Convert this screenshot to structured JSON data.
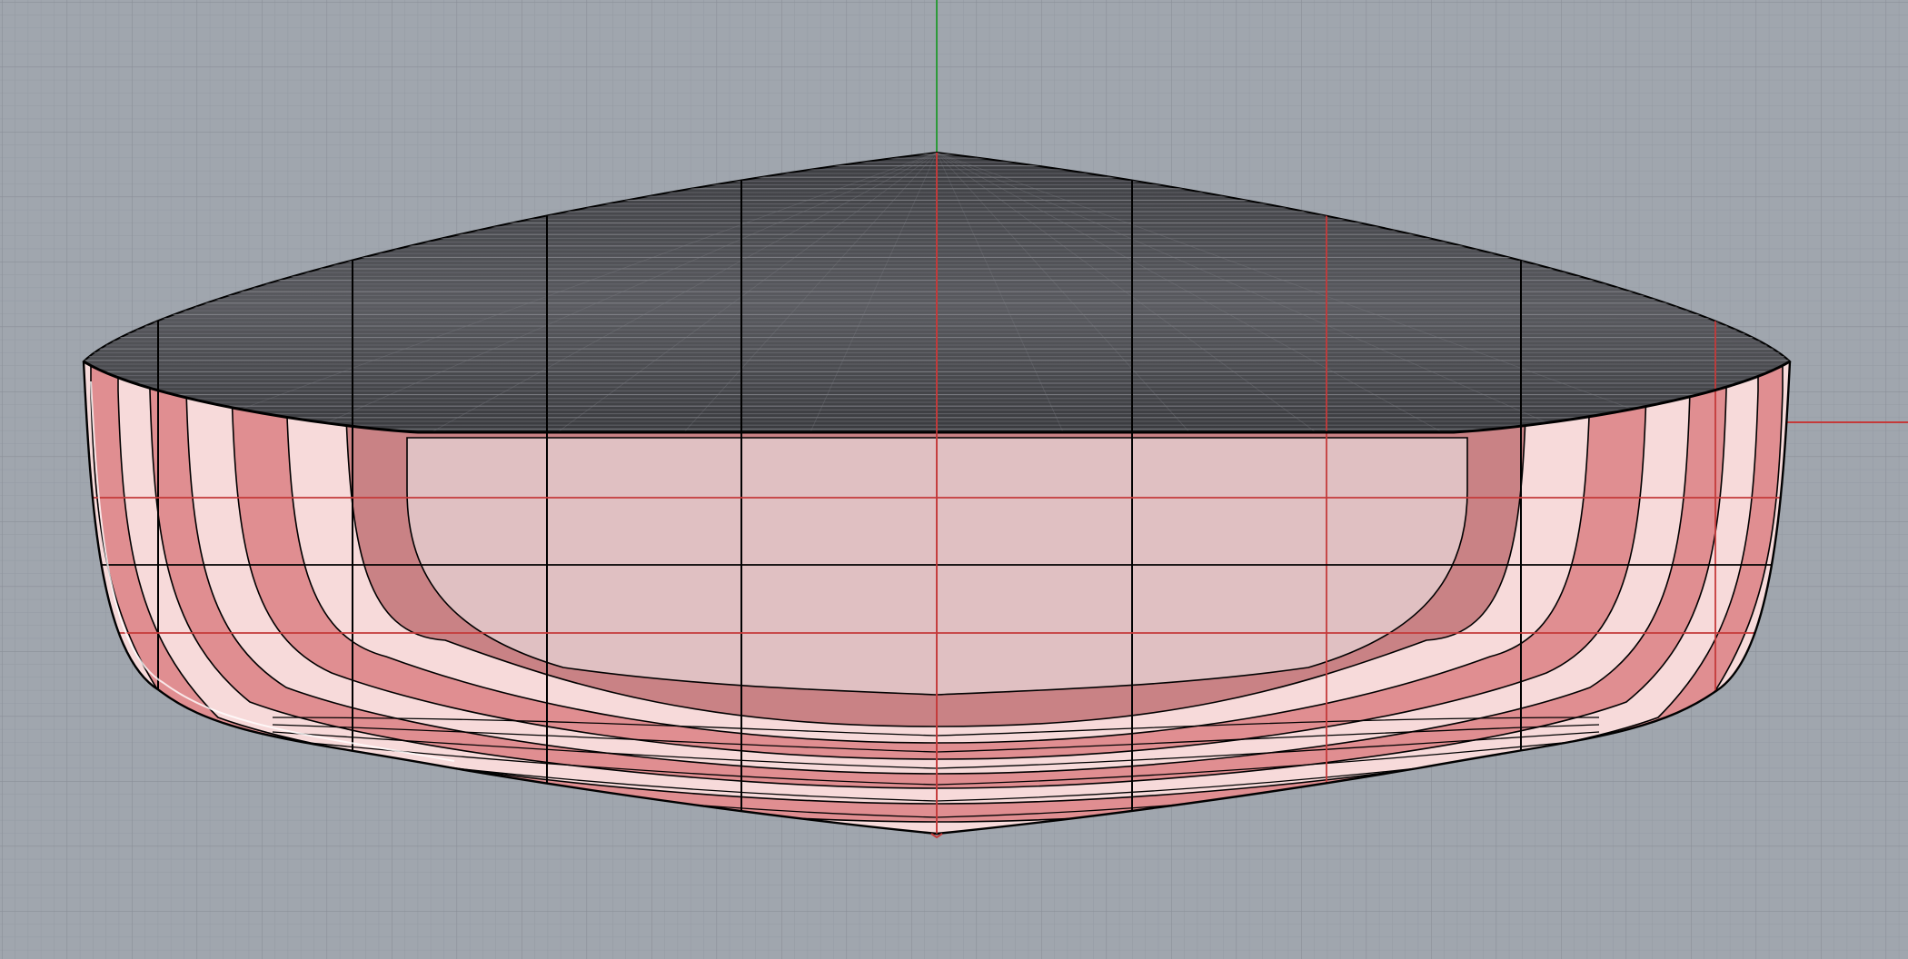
{
  "viewport": {
    "view": "front",
    "background_color": "#a0a6ae",
    "grid": {
      "minor_color": "#949aa3",
      "major_color": "#8a8f98",
      "visible": true
    },
    "axes": {
      "x_axis_color": "#c43a3a",
      "y_axis_color": "#2e9a3a"
    }
  },
  "hull": {
    "deck_color": "#4a4b50",
    "hull_outer_shade": "#e08e91",
    "hull_light_shade": "#f7dada",
    "hull_inner_shade": "#c98285",
    "hull_flat_color": "#e0c0c2",
    "outline_color": "#000000",
    "selection_color": "#c43a3a",
    "station_lines": 9,
    "waterlines": 3,
    "strakes": 9
  }
}
